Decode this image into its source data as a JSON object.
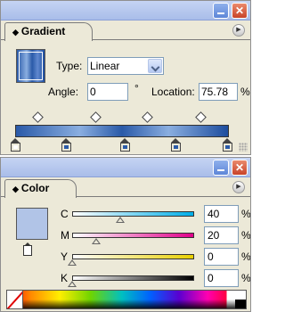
{
  "gradient": {
    "tab_label": "Gradient",
    "type_label": "Type:",
    "type_value": "Linear",
    "angle_label": "Angle:",
    "angle_value": "0",
    "angle_unit": "°",
    "location_label": "Location:",
    "location_value": "75.78",
    "location_unit": "%"
  },
  "color": {
    "tab_label": "Color",
    "channels": [
      {
        "label": "C",
        "value": "40",
        "unit": "%"
      },
      {
        "label": "M",
        "value": "20",
        "unit": "%"
      },
      {
        "label": "Y",
        "value": "0",
        "unit": "%"
      },
      {
        "label": "K",
        "value": "0",
        "unit": "%"
      }
    ],
    "swatch_color": "#b1c4e7"
  },
  "icons": {
    "tab_arrows": "double-arrow-icon",
    "panel_menu": "triangle-right-icon",
    "minimize": "minimize-icon",
    "close": "close-icon"
  }
}
